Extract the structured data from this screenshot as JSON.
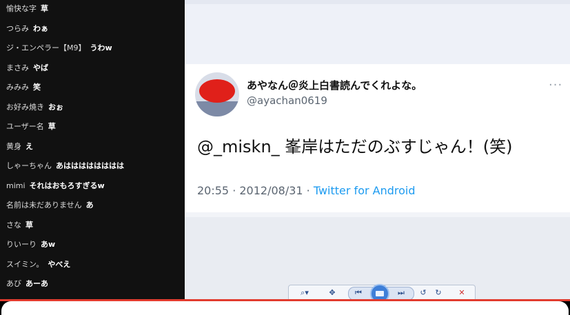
{
  "chat": {
    "messages": [
      {
        "user": "愉快な字",
        "text": "草"
      },
      {
        "user": "つらみ",
        "text": "わぁ"
      },
      {
        "user": "ジ・エンペラー【M9】",
        "text": "うわw"
      },
      {
        "user": "まさみ",
        "text": "やば"
      },
      {
        "user": "みみみ",
        "text": "笑"
      },
      {
        "user": "お好み焼き",
        "text": "おぉ"
      },
      {
        "user": "ユーザー名",
        "text": "草"
      },
      {
        "user": "黄身",
        "text": "え"
      },
      {
        "user": "しゃーちゃん",
        "text": "あはははははははは"
      },
      {
        "user": "mimi",
        "text": "それはおもろすぎるw"
      },
      {
        "user": "名前は未だありません",
        "text": "あ"
      },
      {
        "user": "さな",
        "text": "草"
      },
      {
        "user": "りいーり",
        "text": "あw"
      },
      {
        "user": "スイミン。",
        "text": "やべえ"
      },
      {
        "user": "あび",
        "text": "あーあ"
      }
    ]
  },
  "tweet": {
    "display_name": "あやなん＠炎上白書読んでくれよな。",
    "handle": "@ayachan0619",
    "text": "@_miskn_ 峯岸はただのぶすじゃん！(笑)",
    "time_date": "20:55 · 2012/08/31 · ",
    "client": "Twitter for Android",
    "more": "···"
  },
  "toolbar": {
    "zoom": "⌕▾",
    "fit": "✥",
    "prev": "⏮",
    "next": "⏭",
    "rotate_ccw": "↺",
    "rotate_cw": "↻",
    "delete": "✕"
  },
  "colors": {
    "accent_red": "#e23b2e",
    "twitter_blue": "#1d9bf0"
  }
}
